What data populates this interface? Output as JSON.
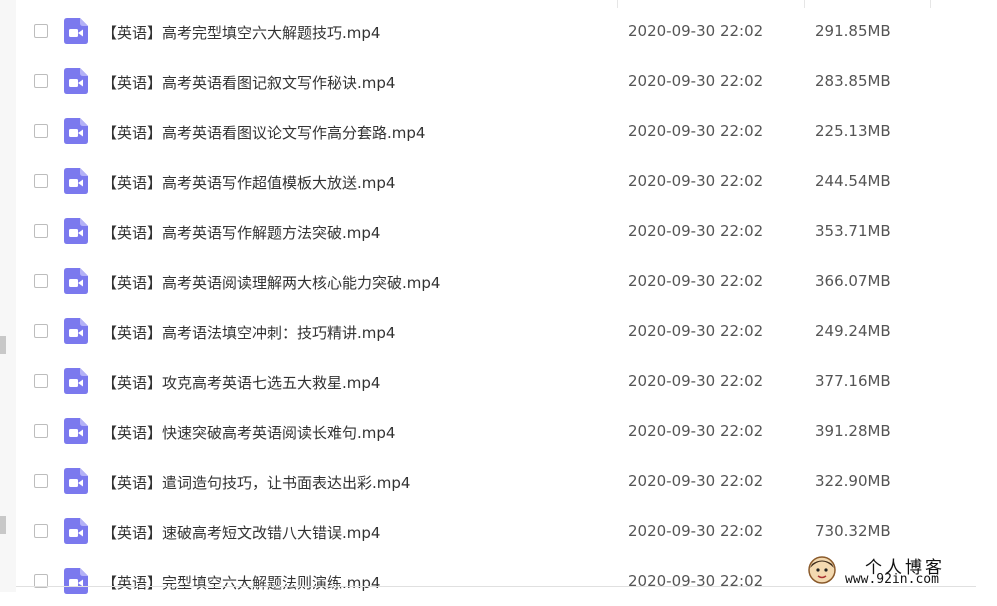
{
  "files": [
    {
      "name": "【英语】高考完型填空六大解题技巧.mp4",
      "modified": "2020-09-30 22:02",
      "size": "291.85MB"
    },
    {
      "name": "【英语】高考英语看图记叙文写作秘诀.mp4",
      "modified": "2020-09-30 22:02",
      "size": "283.85MB"
    },
    {
      "name": "【英语】高考英语看图议论文写作高分套路.mp4",
      "modified": "2020-09-30 22:02",
      "size": "225.13MB"
    },
    {
      "name": "【英语】高考英语写作超值模板大放送.mp4",
      "modified": "2020-09-30 22:02",
      "size": "244.54MB"
    },
    {
      "name": "【英语】高考英语写作解题方法突破.mp4",
      "modified": "2020-09-30 22:02",
      "size": "353.71MB"
    },
    {
      "name": "【英语】高考英语阅读理解两大核心能力突破.mp4",
      "modified": "2020-09-30 22:02",
      "size": "366.07MB"
    },
    {
      "name": "【英语】高考语法填空冲刺：技巧精讲.mp4",
      "modified": "2020-09-30 22:02",
      "size": "249.24MB"
    },
    {
      "name": "【英语】攻克高考英语七选五大救星.mp4",
      "modified": "2020-09-30 22:02",
      "size": "377.16MB"
    },
    {
      "name": "【英语】快速突破高考英语阅读长难句.mp4",
      "modified": "2020-09-30 22:02",
      "size": "391.28MB"
    },
    {
      "name": "【英语】遣词造句技巧，让书面表达出彩.mp4",
      "modified": "2020-09-30 22:02",
      "size": "322.90MB"
    },
    {
      "name": "【英语】速破高考短文改错八大错误.mp4",
      "modified": "2020-09-30 22:02",
      "size": "730.32MB"
    },
    {
      "name": "【英语】完型填空六大解题法则演练.mp4",
      "modified": "2020-09-30 22:02",
      "size": ""
    }
  ],
  "icons": {
    "file_type": "video-file-icon"
  },
  "colors": {
    "video_icon": "#7b79ee"
  },
  "watermark": {
    "title": "个人博客",
    "url": "www.92in.com"
  }
}
